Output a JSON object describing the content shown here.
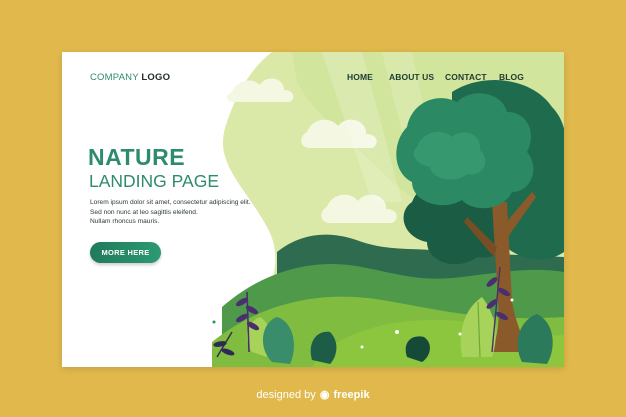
{
  "header": {
    "logo_light": "COMPANY",
    "logo_bold": "LOGO",
    "nav": [
      "HOME",
      "ABOUT US",
      "CONTACT",
      "BLOG"
    ]
  },
  "hero": {
    "title": "NATURE",
    "subtitle": "LANDING PAGE",
    "body_lines": [
      "Lorem ipsum dolor sit amet, consectetur adipiscing elit.",
      "Sed non nunc at leo sagittis eleifend.",
      "Nullam rhoncus mauris."
    ],
    "cta_label": "MORE HERE"
  },
  "footer": {
    "designed_by": "designed by",
    "brand": "freepik",
    "brand_icon": "freepik-icon"
  },
  "colors": {
    "background": "#e0b84c",
    "accent": "#2e8b6f",
    "cta": "#1f7a5b"
  }
}
